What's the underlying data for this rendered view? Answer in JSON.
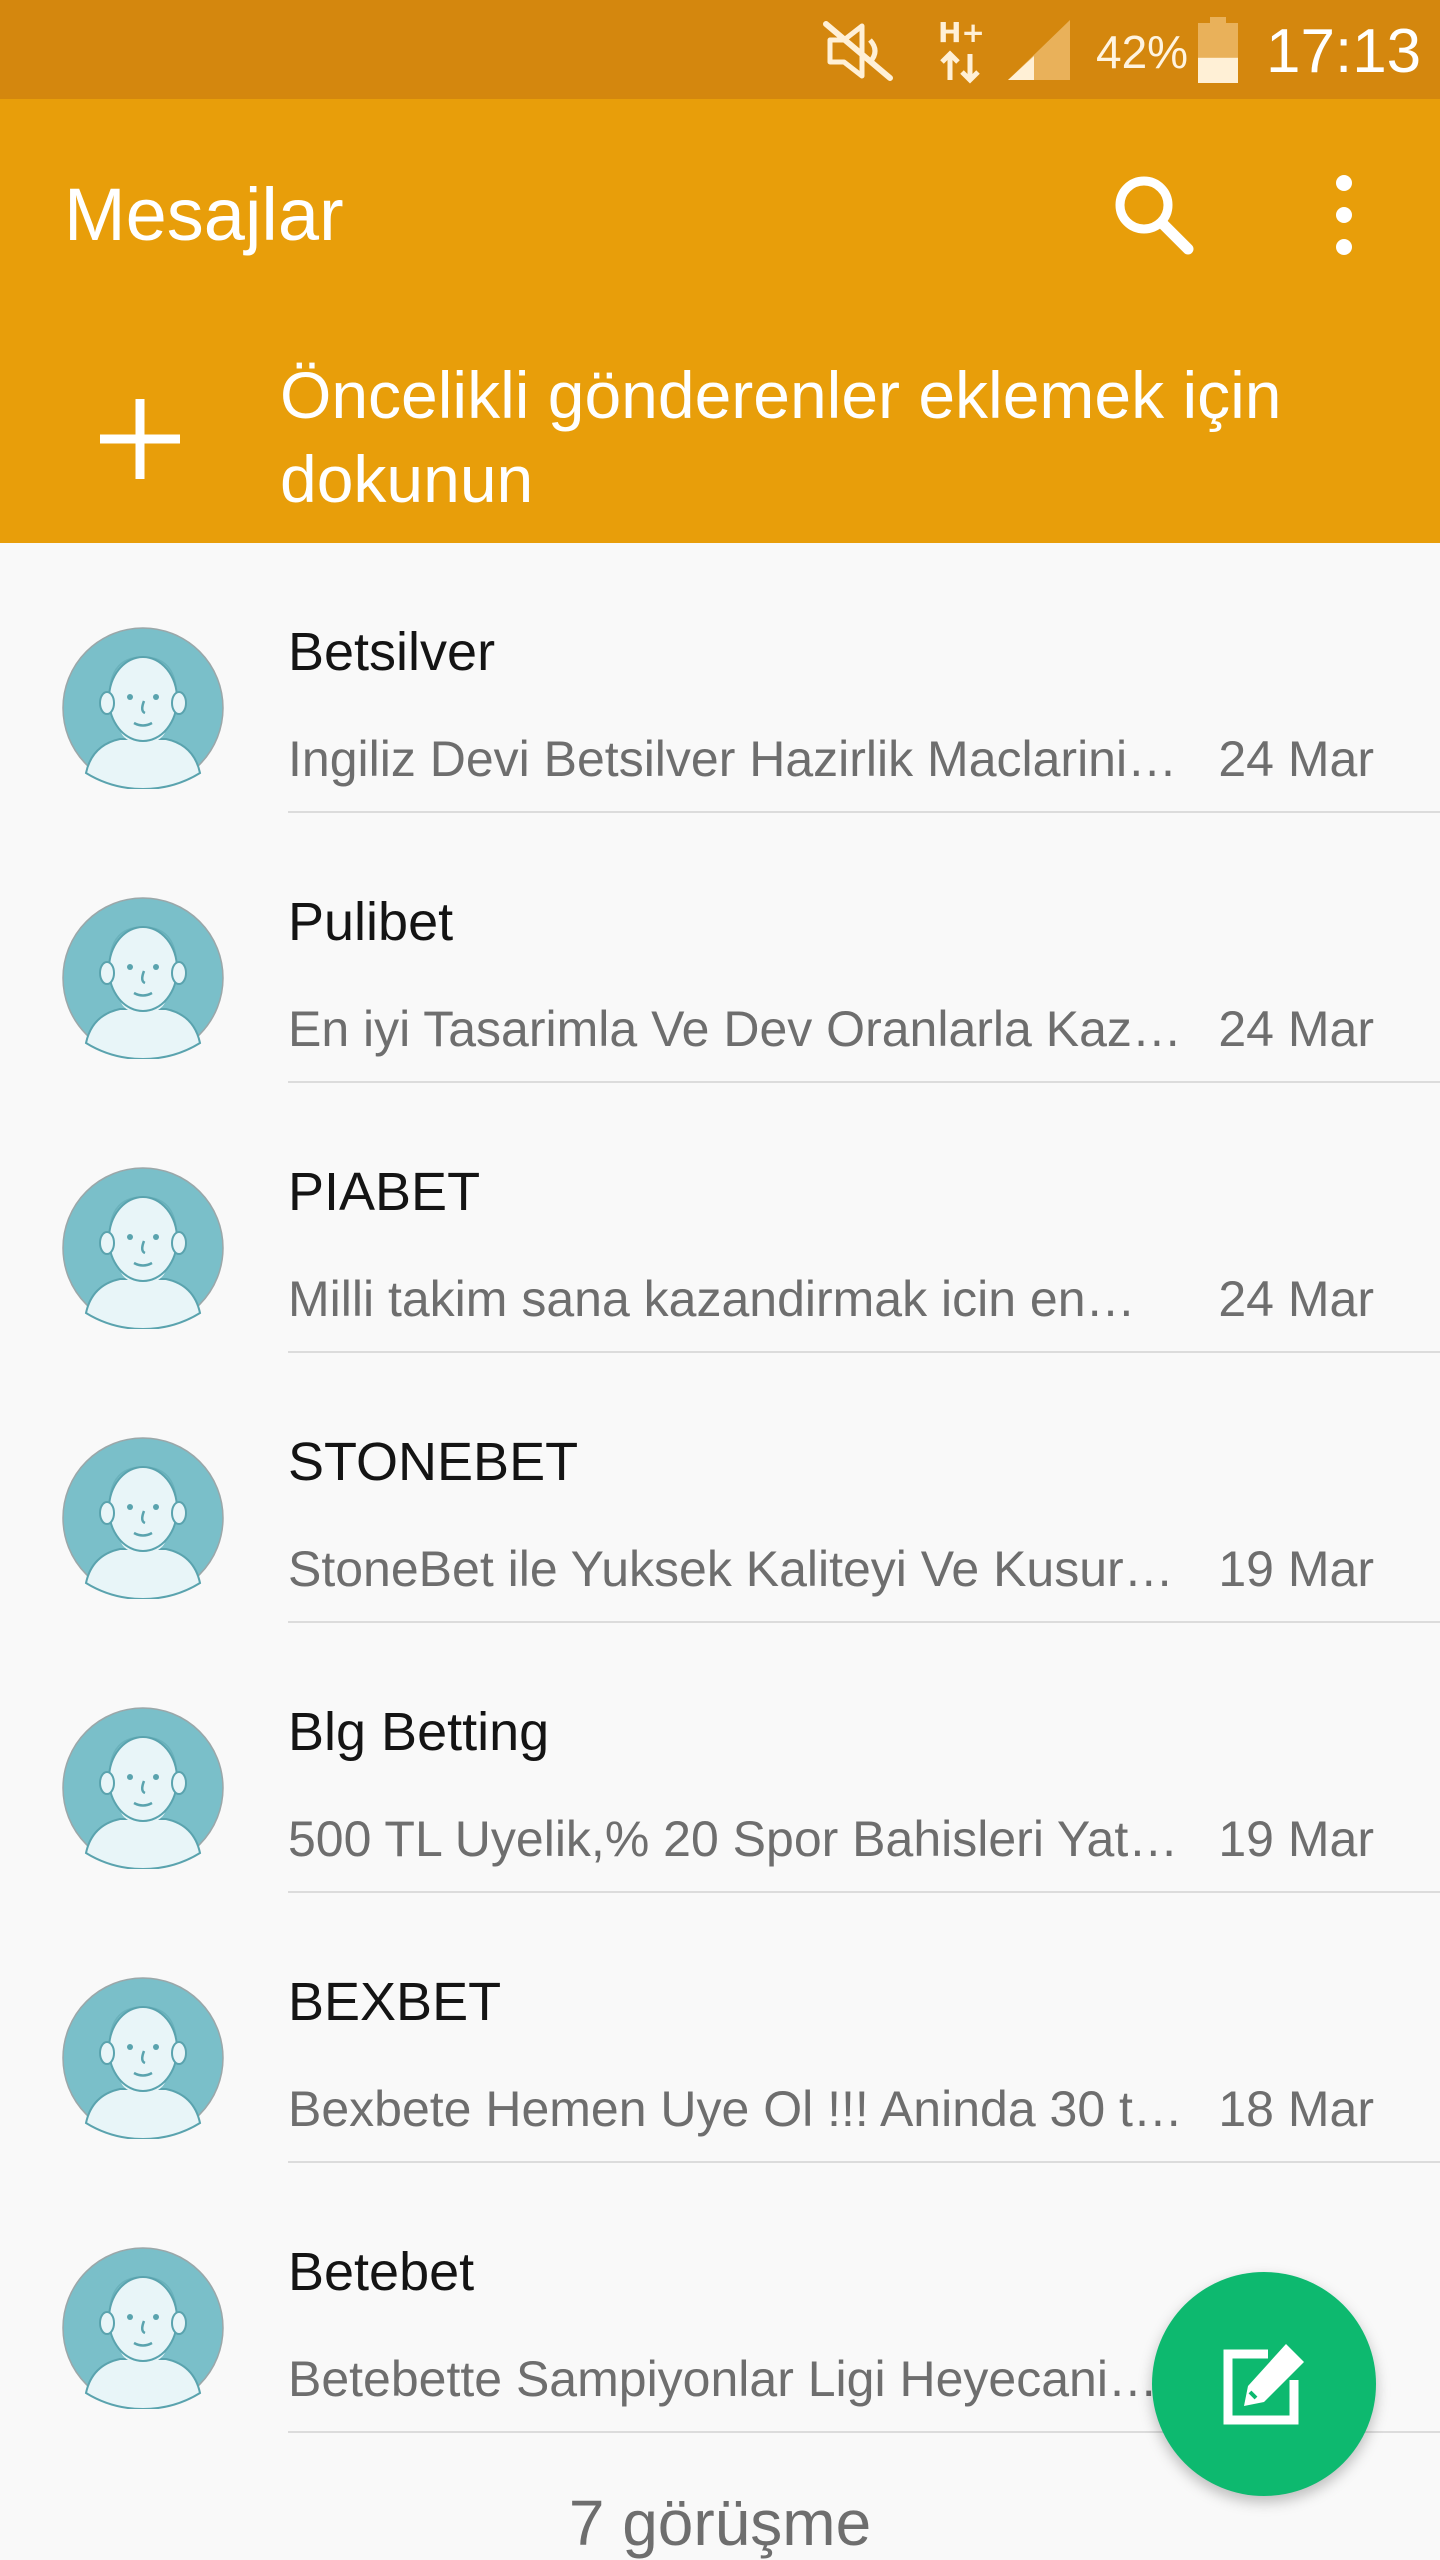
{
  "status_bar": {
    "network_label": "H+",
    "battery_percent": "42%",
    "battery_level": 0.42,
    "time": "17:13",
    "icons": [
      "mute-icon",
      "network-hplus-icon",
      "signal-icon",
      "battery-icon"
    ]
  },
  "app_bar": {
    "title": "Mesajlar",
    "search_icon": "search-icon",
    "menu_icon": "more-vert-icon",
    "priority_text": "Öncelikli gönderenler eklemek için dokunun"
  },
  "conversations": [
    {
      "name": "Betsilver",
      "snippet": "Ingiliz Devi Betsilver Hazirlik Maclarini…",
      "date": "24 Mar"
    },
    {
      "name": "Pulibet",
      "snippet": "En iyi Tasarimla Ve Dev Oranlarla Kaz…",
      "date": "24 Mar"
    },
    {
      "name": "PIABET",
      "snippet": "Milli takim sana kazandirmak icin en…",
      "date": "24 Mar"
    },
    {
      "name": "STONEBET",
      "snippet": "StoneBet ile Yuksek Kaliteyi Ve Kusur…",
      "date": "19 Mar"
    },
    {
      "name": "Blg Betting",
      "snippet": "500 TL Uyelik,% 20 Spor Bahisleri Yati…",
      "date": "19 Mar"
    },
    {
      "name": "BEXBET",
      "snippet": "Bexbete Hemen Uye Ol !!! Aninda 30 tl…",
      "date": "18 Mar"
    },
    {
      "name": "Betebet",
      "snippet": "Betebette Sampiyonlar Ligi Heyecani…",
      "date": ""
    }
  ],
  "footer": {
    "count_text": "7 görüşme"
  },
  "fab": {
    "icon": "compose-icon"
  },
  "colors": {
    "status_bar": "#d4870e",
    "app_bar": "#e89e0a",
    "fab": "#0db96f",
    "avatar_bg": "#7abfc9"
  }
}
